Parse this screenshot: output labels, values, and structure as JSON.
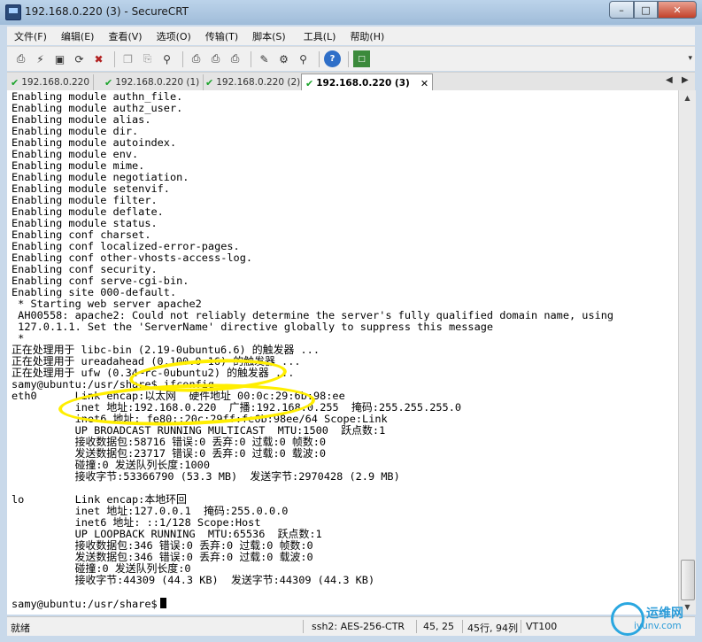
{
  "window": {
    "title": "192.168.0.220 (3) - SecureCRT",
    "controls": {
      "minimize": "–",
      "maximize": "□",
      "close": "✕"
    }
  },
  "menu": [
    "文件(F)",
    "编辑(E)",
    "查看(V)",
    "选项(O)",
    "传输(T)",
    "脚本(S)",
    "工具(L)",
    "帮助(H)"
  ],
  "toolbar": {
    "icons": [
      "connect-icon",
      "quick-connect-icon",
      "connect-tab-icon",
      "reconnect-icon",
      "disconnect-icon",
      "copy-icon",
      "paste-icon",
      "find-icon",
      "print-setup-icon",
      "print-icon",
      "print-screen-icon",
      "session-options-icon",
      "global-options-icon",
      "keymap-icon",
      "help-icon",
      "sftp-icon"
    ],
    "more": "▾"
  },
  "tabs": [
    {
      "label": "192.168.0.220",
      "active": false
    },
    {
      "label": "192.168.0.220 (1)",
      "active": false
    },
    {
      "label": "192.168.0.220 (2)",
      "active": false
    },
    {
      "label": "192.168.0.220 (3)",
      "active": true
    }
  ],
  "tab_close": "✕",
  "tab_nav": {
    "prev": "◀",
    "next": "▶"
  },
  "terminal_lines": [
    "Enabling module authn_file.",
    "Enabling module authz_user.",
    "Enabling module alias.",
    "Enabling module dir.",
    "Enabling module autoindex.",
    "Enabling module env.",
    "Enabling module mime.",
    "Enabling module negotiation.",
    "Enabling module setenvif.",
    "Enabling module filter.",
    "Enabling module deflate.",
    "Enabling module status.",
    "Enabling conf charset.",
    "Enabling conf localized-error-pages.",
    "Enabling conf other-vhosts-access-log.",
    "Enabling conf security.",
    "Enabling conf serve-cgi-bin.",
    "Enabling site 000-default.",
    " * Starting web server apache2",
    " AH00558: apache2: Could not reliably determine the server's fully qualified domain name, using",
    " 127.0.1.1. Set the 'ServerName' directive globally to suppress this message",
    " *",
    "正在处理用于 libc-bin (2.19-0ubuntu6.6) 的触发器 ...",
    "正在处理用于 ureadahead (0.100.0-16) 的触发器 ...",
    "正在处理用于 ufw (0.34~rc-0ubuntu2) 的触发器 ...",
    "samy@ubuntu:/usr/share$ ifconfig",
    "eth0      Link encap:以太网  硬件地址 00:0c:29:6b:98:ee",
    "          inet 地址:192.168.0.220  广播:192.168.0.255  掩码:255.255.255.0",
    "          inet6 地址: fe80::20c:29ff:fe6b:98ee/64 Scope:Link",
    "          UP BROADCAST RUNNING MULTICAST  MTU:1500  跃点数:1",
    "          接收数据包:58716 错误:0 丢弃:0 过载:0 帧数:0",
    "          发送数据包:23717 错误:0 丢弃:0 过载:0 载波:0",
    "          碰撞:0 发送队列长度:1000",
    "          接收字节:53366790 (53.3 MB)  发送字节:2970428 (2.9 MB)",
    "",
    "lo        Link encap:本地环回",
    "          inet 地址:127.0.0.1  掩码:255.0.0.0",
    "          inet6 地址: ::1/128 Scope:Host",
    "          UP LOOPBACK RUNNING  MTU:65536  跃点数:1",
    "          接收数据包:346 错误:0 丢弃:0 过载:0 帧数:0",
    "          发送数据包:346 错误:0 丢弃:0 过载:0 载波:0",
    "          碰撞:0 发送队列长度:0",
    "          接收字节:44309 (44.3 KB)  发送字节:44309 (44.3 KB)",
    "",
    "samy@ubuntu:/usr/share$"
  ],
  "scrollbar": {
    "up": "▲",
    "down": "▼"
  },
  "status": {
    "ready": "就绪",
    "cipher": "ssh2: AES-256-CTR",
    "cursor_pos": "45,  25",
    "size": "45行, 94列",
    "terminal_type": "VT100"
  },
  "colors": {
    "annotation": "#ffee00",
    "tab_check": "#1aa32a",
    "watermark": "#2aa7e0"
  },
  "watermark": {
    "brand": "运维网",
    "domain": "iyunv.com"
  }
}
